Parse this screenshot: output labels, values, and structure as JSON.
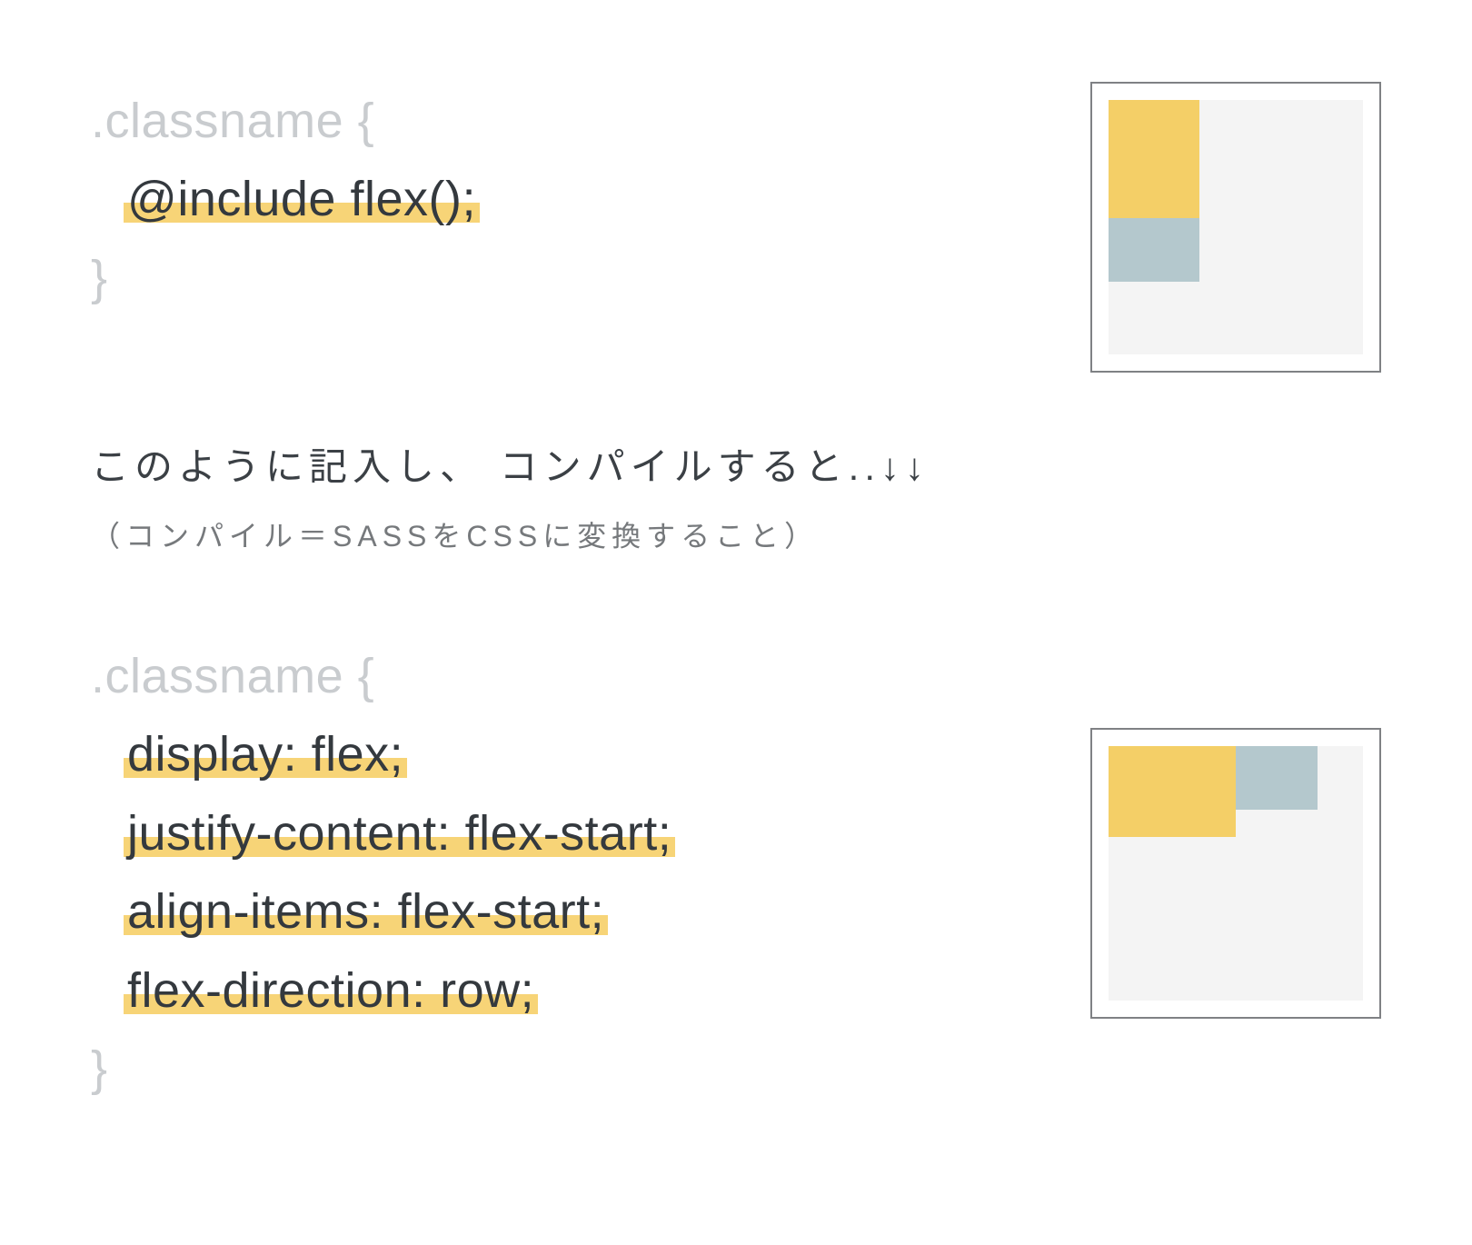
{
  "block1": {
    "selector": ".classname {",
    "line1": "@include flex();",
    "close": "}"
  },
  "captions": {
    "main": "このように記入し、 コンパイルすると..↓↓",
    "sub": "（コンパイル＝SASSをCSSに変換すること）"
  },
  "block2": {
    "selector": ".classname {",
    "line1": "display: flex;",
    "line2": "justify-content: flex-start;",
    "line3": "align-items: flex-start;",
    "line4": "flex-direction: row;",
    "close": "}"
  },
  "colors": {
    "highlight": "#f7d477",
    "box_yellow": "#f4cf67",
    "box_blue": "#b4c8cd",
    "muted": "#c9cccf"
  },
  "diagram1": {
    "direction": "column",
    "boxes": [
      "yellow",
      "blue"
    ]
  },
  "diagram2": {
    "direction": "row",
    "boxes": [
      "yellow",
      "blue"
    ]
  }
}
